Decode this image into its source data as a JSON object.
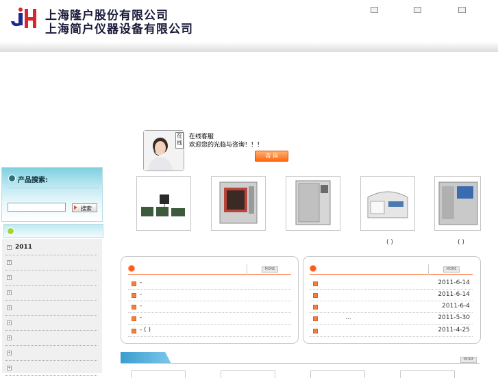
{
  "header": {
    "company_line1": "上海隆户股份有限公司",
    "company_line2": "上海简户仪器设备有限公司",
    "icons": [
      "home-icon",
      "sitemap-icon",
      "bookmark-icon"
    ]
  },
  "service": {
    "online_label": "在线",
    "line1": "在线客服",
    "line2": "欢迎您的光临与咨询！！！",
    "button_label": "咨 询"
  },
  "sidebar": {
    "search_title": "产品搜索:",
    "search_placeholder": "",
    "search_button": "搜索",
    "categories": [
      "2011",
      "",
      "",
      "",
      "",
      "",
      "",
      "",
      ""
    ]
  },
  "products": {
    "labels": [
      "",
      "",
      "",
      "( )",
      "( )"
    ]
  },
  "news_left": {
    "more": "MORE",
    "items": [
      {
        "text": "-"
      },
      {
        "text": "-"
      },
      {
        "text": "-"
      },
      {
        "text": "-"
      },
      {
        "text": "-  ( )"
      }
    ]
  },
  "news_right": {
    "more": "MORE",
    "items": [
      {
        "text": "",
        "date": "2011-6-14"
      },
      {
        "text": "",
        "date": "2011-6-14"
      },
      {
        "text": "",
        "date": "2011-6-4"
      },
      {
        "text": "...",
        "date": "2011-5-30"
      },
      {
        "text": "",
        "date": "2011-4-25"
      }
    ]
  },
  "bottom": {
    "more": "MORE"
  },
  "colors": {
    "accent_orange": "#ff5a1a",
    "sidebar_cyan": "#7fd0e0",
    "tab_blue": "#3a9ed0"
  }
}
